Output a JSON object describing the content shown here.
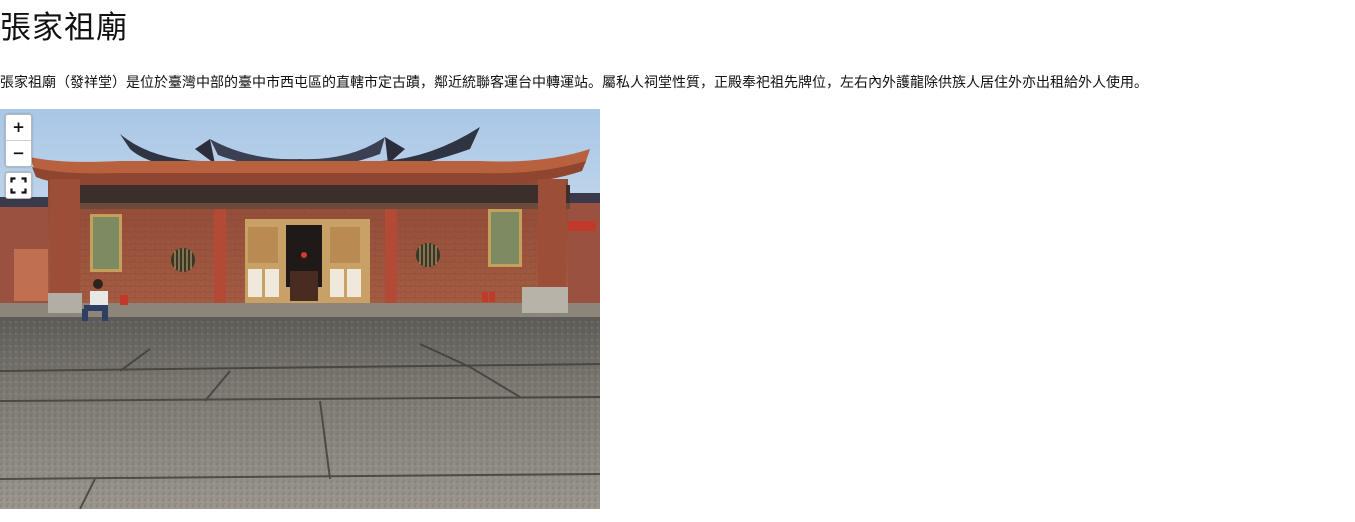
{
  "page": {
    "title": "張家祖廟",
    "description": "張家祖廟（發祥堂）是位於臺灣中部的臺中市西屯區的直轄市定古蹟，鄰近統聯客運台中轉運站。屬私人祠堂性質，正殿奉祀祖先牌位，左右內外護龍除供族人居住外亦出租給外人使用。"
  },
  "viewer": {
    "zoom_in_label": "+",
    "zoom_out_label": "−",
    "fullscreen_icon": "fullscreen-icon",
    "colors": {
      "sky": "#b9d3ec",
      "roof_tile": "#b35a3a",
      "brick": "#a4573f",
      "pavement": "#7d7a74"
    }
  }
}
